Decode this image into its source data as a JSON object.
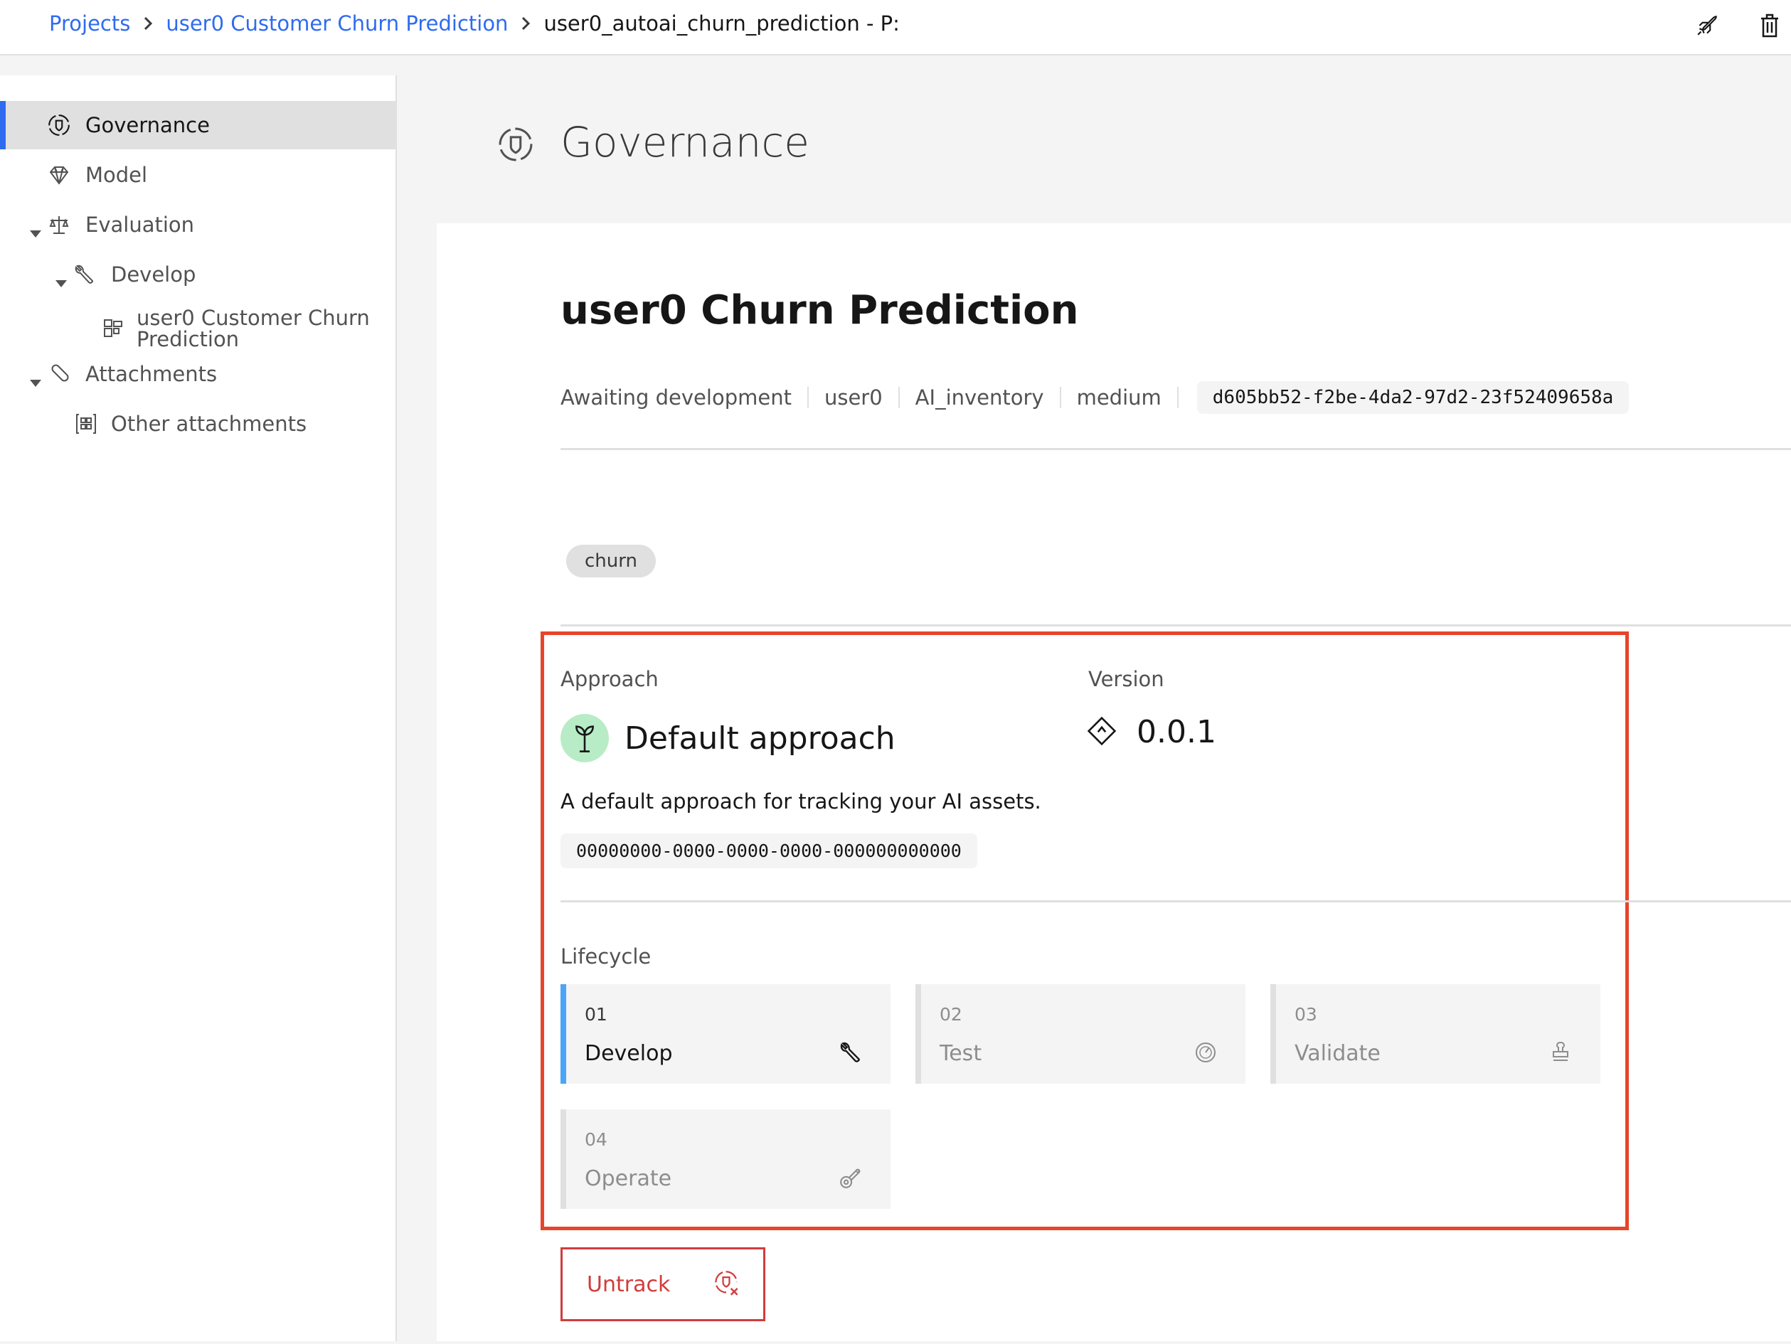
{
  "breadcrumb": {
    "items": [
      {
        "label": "Projects"
      },
      {
        "label": "user0 Customer Churn Prediction"
      }
    ],
    "current": "user0_autoai_churn_prediction - P:"
  },
  "top_actions": {
    "deploy_icon": "rocket-icon",
    "delete_icon": "trash-icon"
  },
  "sidebar": {
    "items": [
      {
        "label": "Governance",
        "icon": "governance-icon",
        "active": true
      },
      {
        "label": "Model",
        "icon": "diamond-icon"
      },
      {
        "label": "Evaluation",
        "icon": "scale-icon",
        "expanded": true
      },
      {
        "label": "Develop",
        "icon": "wrench-icon",
        "expanded": true
      },
      {
        "label": "user0 Customer Churn Prediction",
        "icon": "grid-icon"
      },
      {
        "label": "Attachments",
        "icon": "paperclip-icon",
        "expanded": true
      },
      {
        "label": "Other attachments",
        "icon": "attachment-grid-icon"
      }
    ]
  },
  "header": {
    "title": "Governance"
  },
  "asset": {
    "title": "user0 Churn Prediction",
    "meta": {
      "status": "Awaiting development",
      "owner": "user0",
      "inventory": "AI_inventory",
      "risk": "medium",
      "id": "d605bb52-f2be-4da2-97d2-23f52409658a"
    },
    "tags": [
      "churn"
    ]
  },
  "approach": {
    "label": "Approach",
    "name": "Default approach",
    "description": "A default approach for tracking your AI assets.",
    "id": "00000000-0000-0000-0000-000000000000"
  },
  "version": {
    "label": "Version",
    "value": "0.0.1"
  },
  "lifecycle": {
    "label": "Lifecycle",
    "phases": [
      {
        "num": "01",
        "name": "Develop",
        "icon": "wrench-icon",
        "current": true
      },
      {
        "num": "02",
        "name": "Test",
        "icon": "gauge-icon"
      },
      {
        "num": "03",
        "name": "Validate",
        "icon": "stamp-icon"
      },
      {
        "num": "04",
        "name": "Operate",
        "icon": "operate-icon"
      }
    ]
  },
  "actions": {
    "untrack_label": "Untrack"
  },
  "colors": {
    "link": "#2e6bef",
    "highlight_border": "#e8442a",
    "danger": "#d13c3c",
    "current_phase": "#4aa5f9",
    "approach_bg": "#b7ecc6"
  }
}
